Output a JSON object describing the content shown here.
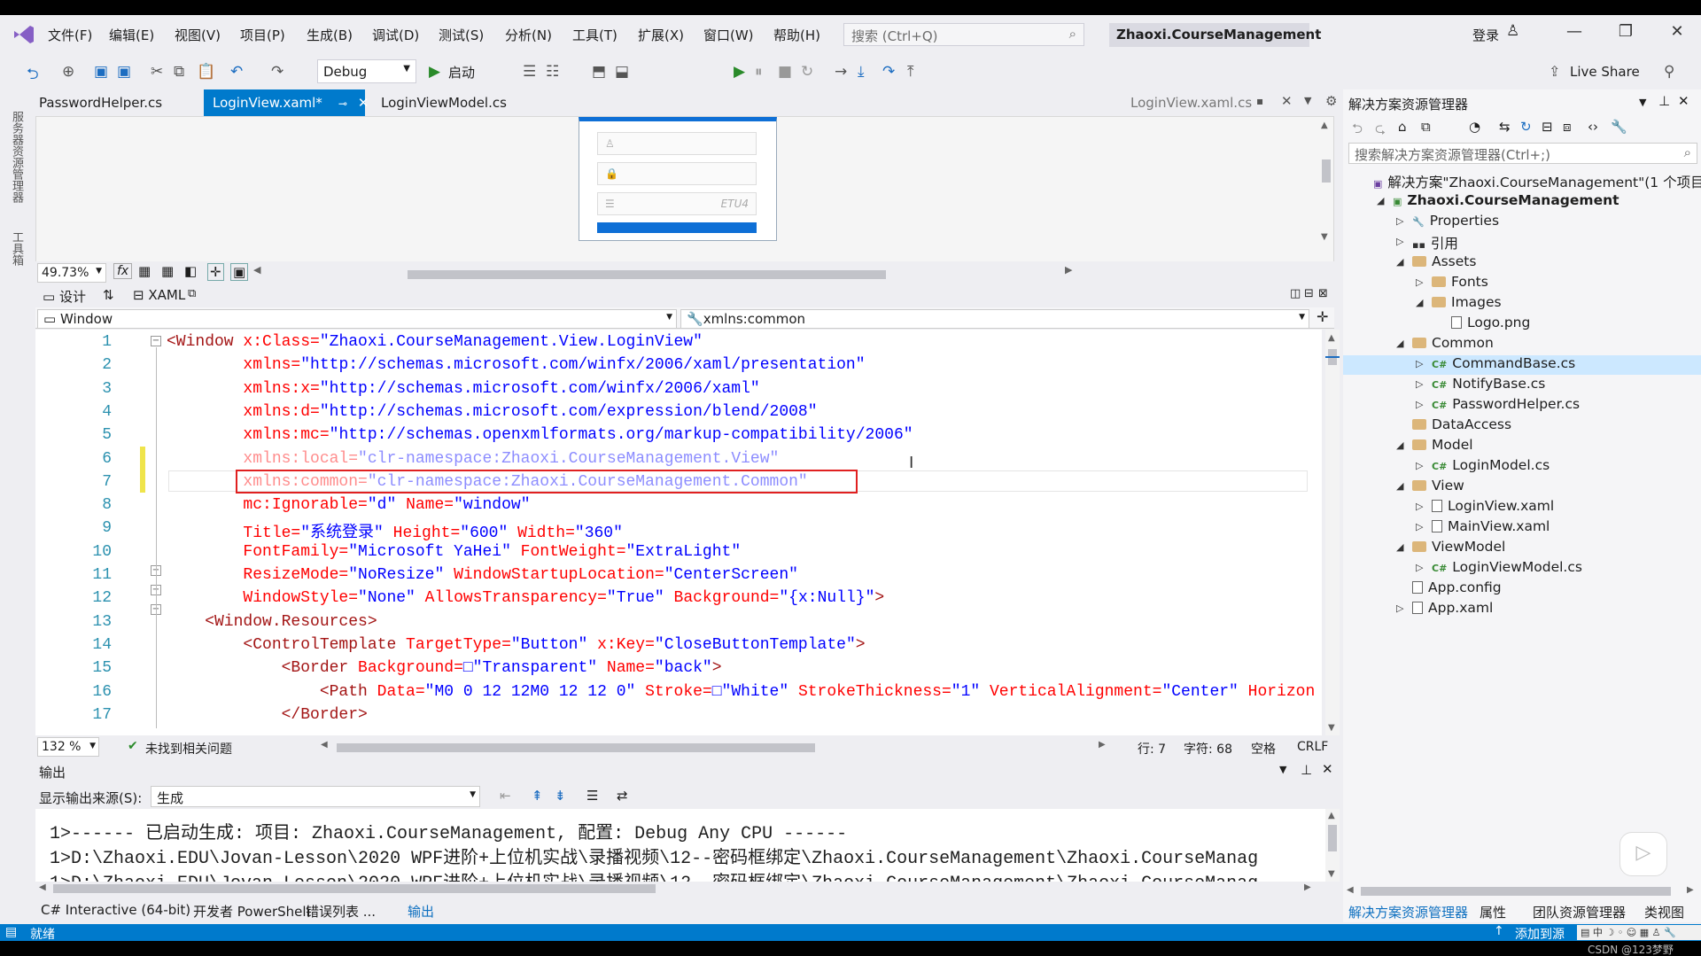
{
  "title": {
    "menus": [
      "文件(F)",
      "编辑(E)",
      "视图(V)",
      "项目(P)",
      "生成(B)",
      "调试(D)",
      "测试(S)",
      "分析(N)",
      "工具(T)",
      "扩展(X)",
      "窗口(W)",
      "帮助(H)"
    ],
    "search_placeholder": "搜索 (Ctrl+Q)",
    "solution_name": "Zhaoxi.CourseManagement",
    "login": "登录"
  },
  "toolbar": {
    "config": "Debug",
    "start": "启动",
    "live_share": "Live Share"
  },
  "left_strip": [
    "服务器资源管理器",
    "工具箱"
  ],
  "tabs": {
    "left": [
      "PasswordHelper.cs",
      "LoginView.xaml*",
      "LoginViewModel.cs"
    ],
    "preview": "LoginView.xaml.cs"
  },
  "designer": {
    "zoom": "49.73%",
    "design_tab": "设计",
    "xaml_tab": "XAML",
    "preview_text": "ETU4"
  },
  "navbar": {
    "left": "Window",
    "right": "xmlns:common"
  },
  "code": {
    "line_numbers": [
      "1",
      "2",
      "3",
      "4",
      "5",
      "6",
      "7",
      "8",
      "9",
      "10",
      "11",
      "12",
      "13",
      "14",
      "15",
      "16",
      "17"
    ],
    "lines": [
      {
        "t": [
          [
            "tag",
            "<Window "
          ],
          [
            "attr",
            "x:Class="
          ],
          [
            "val",
            "\"Zhaoxi.CourseManagement.View.LoginView\""
          ]
        ]
      },
      {
        "t": [
          [
            "attr",
            "        xmlns="
          ],
          [
            "val",
            "\"http://schemas.microsoft.com/winfx/2006/xaml/presentation\""
          ]
        ]
      },
      {
        "t": [
          [
            "attr",
            "        xmlns:x="
          ],
          [
            "val",
            "\"http://schemas.microsoft.com/winfx/2006/xaml\""
          ]
        ]
      },
      {
        "t": [
          [
            "attr",
            "        xmlns:d="
          ],
          [
            "val",
            "\"http://schemas.microsoft.com/expression/blend/2008\""
          ]
        ]
      },
      {
        "t": [
          [
            "attr",
            "        xmlns:mc="
          ],
          [
            "val",
            "\"http://schemas.openxmlformats.org/markup-compatibility/2006\""
          ]
        ]
      },
      {
        "t": [
          [
            "attr dim",
            "        xmlns:local="
          ],
          [
            "val dim",
            "\"clr-namespace:Zhaoxi.CourseManagement.View\""
          ]
        ]
      },
      {
        "t": [
          [
            "attr dim",
            "        xmlns:common="
          ],
          [
            "val dim",
            "\"clr-namespace:Zhaoxi.CourseManagement.Common\""
          ]
        ]
      },
      {
        "t": [
          [
            "attr",
            "        mc:Ignorable="
          ],
          [
            "val",
            "\"d\" "
          ],
          [
            "attr",
            "Name="
          ],
          [
            "val",
            "\"window\""
          ]
        ]
      },
      {
        "t": [
          [
            "attr",
            "        Title="
          ],
          [
            "val",
            "\"系统登录\" "
          ],
          [
            "attr",
            "Height="
          ],
          [
            "val",
            "\"600\" "
          ],
          [
            "attr",
            "Width="
          ],
          [
            "val",
            "\"360\""
          ]
        ]
      },
      {
        "t": [
          [
            "attr",
            "        FontFamily="
          ],
          [
            "val",
            "\"Microsoft YaHei\" "
          ],
          [
            "attr",
            "FontWeight="
          ],
          [
            "val",
            "\"ExtraLight\""
          ]
        ]
      },
      {
        "t": [
          [
            "attr",
            "        ResizeMode="
          ],
          [
            "val",
            "\"NoResize\" "
          ],
          [
            "attr",
            "WindowStartupLocation="
          ],
          [
            "val",
            "\"CenterScreen\""
          ]
        ]
      },
      {
        "t": [
          [
            "attr",
            "        WindowStyle="
          ],
          [
            "val",
            "\"None\" "
          ],
          [
            "attr",
            "AllowsTransparency="
          ],
          [
            "val",
            "\"True\" "
          ],
          [
            "attr",
            "Background="
          ],
          [
            "val",
            "\"{x:Null}\""
          ],
          [
            "tag",
            ">"
          ]
        ]
      },
      {
        "t": [
          [
            "tag",
            "    <Window.Resources>"
          ]
        ]
      },
      {
        "t": [
          [
            "tag",
            "        <ControlTemplate "
          ],
          [
            "attr",
            "TargetType="
          ],
          [
            "val",
            "\"Button\" "
          ],
          [
            "attr",
            "x:Key="
          ],
          [
            "val",
            "\"CloseButtonTemplate\""
          ],
          [
            "tag",
            ">"
          ]
        ]
      },
      {
        "t": [
          [
            "tag",
            "            <Border "
          ],
          [
            "attr",
            "Background="
          ],
          [
            "val",
            "□\"Transparent\" "
          ],
          [
            "attr",
            "Name="
          ],
          [
            "val",
            "\"back\""
          ],
          [
            "tag",
            ">"
          ]
        ]
      },
      {
        "t": [
          [
            "tag",
            "                <Path "
          ],
          [
            "attr",
            "Data="
          ],
          [
            "val",
            "\"M0 0 12 12M0 12 12 0\" "
          ],
          [
            "attr",
            "Stroke="
          ],
          [
            "val",
            "□\"White\" "
          ],
          [
            "attr",
            "StrokeThickness="
          ],
          [
            "val",
            "\"1\" "
          ],
          [
            "attr",
            "VerticalAlignment="
          ],
          [
            "val",
            "\"Center\" "
          ],
          [
            "attr",
            "Horizon"
          ]
        ]
      },
      {
        "t": [
          [
            "tag",
            "            </Border>"
          ]
        ]
      }
    ]
  },
  "editor_status": {
    "zoom": "132 %",
    "issues": "未找到相关问题",
    "line": "行: 7",
    "char": "字符: 68",
    "space": "空格",
    "eol": "CRLF"
  },
  "output": {
    "title": "输出",
    "source_label": "显示输出来源(S):",
    "source_value": "生成",
    "lines": [
      "1>------ 已启动生成: 项目: Zhaoxi.CourseManagement, 配置: Debug Any CPU ------",
      "1>D:\\Zhaoxi.EDU\\Jovan-Lesson\\2020 WPF进阶+上位机实战\\录播视频\\12--密码框绑定\\Zhaoxi.CourseManagement\\Zhaoxi.CourseManag",
      "1>D:\\Zhaoxi.EDU\\Jovan-Lesson\\2020 WPF进阶+上位机实战\\录播视频\\12--密码框绑定\\Zhaoxi.CourseManagement\\Zhaoxi.CourseManag"
    ],
    "tabs": [
      "C# Interactive (64-bit)",
      "开发者 PowerShell",
      "错误列表 ...",
      "输出"
    ]
  },
  "solution_explorer": {
    "title": "解决方案资源管理器",
    "search": "搜索解决方案资源管理器(Ctrl+;)",
    "nodes": [
      {
        "label": "解决方案\"Zhaoxi.CourseManagement\"(1 个项目/共",
        "indent": 0,
        "kind": "sln",
        "arrow": ""
      },
      {
        "label": "Zhaoxi.CourseManagement",
        "indent": 1,
        "kind": "proj",
        "arrow": "◢",
        "bold": true
      },
      {
        "label": "Properties",
        "indent": 2,
        "kind": "prop",
        "arrow": "▷"
      },
      {
        "label": "引用",
        "indent": 2,
        "kind": "ref",
        "arrow": "▷"
      },
      {
        "label": "Assets",
        "indent": 2,
        "kind": "folder",
        "arrow": "◢"
      },
      {
        "label": "Fonts",
        "indent": 3,
        "kind": "folder",
        "arrow": "▷"
      },
      {
        "label": "Images",
        "indent": 3,
        "kind": "folder",
        "arrow": "◢"
      },
      {
        "label": "Logo.png",
        "indent": 4,
        "kind": "file",
        "arrow": ""
      },
      {
        "label": "Common",
        "indent": 2,
        "kind": "folder",
        "arrow": "◢"
      },
      {
        "label": "CommandBase.cs",
        "indent": 3,
        "kind": "cs",
        "arrow": "▷"
      },
      {
        "label": "NotifyBase.cs",
        "indent": 3,
        "kind": "cs",
        "arrow": "▷"
      },
      {
        "label": "PasswordHelper.cs",
        "indent": 3,
        "kind": "cs",
        "arrow": "▷"
      },
      {
        "label": "DataAccess",
        "indent": 2,
        "kind": "folder",
        "arrow": ""
      },
      {
        "label": "Model",
        "indent": 2,
        "kind": "folder",
        "arrow": "◢"
      },
      {
        "label": "LoginModel.cs",
        "indent": 3,
        "kind": "cs",
        "arrow": "▷"
      },
      {
        "label": "View",
        "indent": 2,
        "kind": "folder",
        "arrow": "◢"
      },
      {
        "label": "LoginView.xaml",
        "indent": 3,
        "kind": "file",
        "arrow": "▷"
      },
      {
        "label": "MainView.xaml",
        "indent": 3,
        "kind": "file",
        "arrow": "▷"
      },
      {
        "label": "ViewModel",
        "indent": 2,
        "kind": "folder",
        "arrow": "◢"
      },
      {
        "label": "LoginViewModel.cs",
        "indent": 3,
        "kind": "cs",
        "arrow": "▷"
      },
      {
        "label": "App.config",
        "indent": 2,
        "kind": "file",
        "arrow": ""
      },
      {
        "label": "App.xaml",
        "indent": 2,
        "kind": "file",
        "arrow": "▷"
      }
    ],
    "tabs": [
      "解决方案资源管理器",
      "属性",
      "团队资源管理器",
      "类视图"
    ]
  },
  "statusbar": {
    "ready": "就绪",
    "add_source": "添加到源",
    "watermark": "CSDN @123梦野"
  }
}
